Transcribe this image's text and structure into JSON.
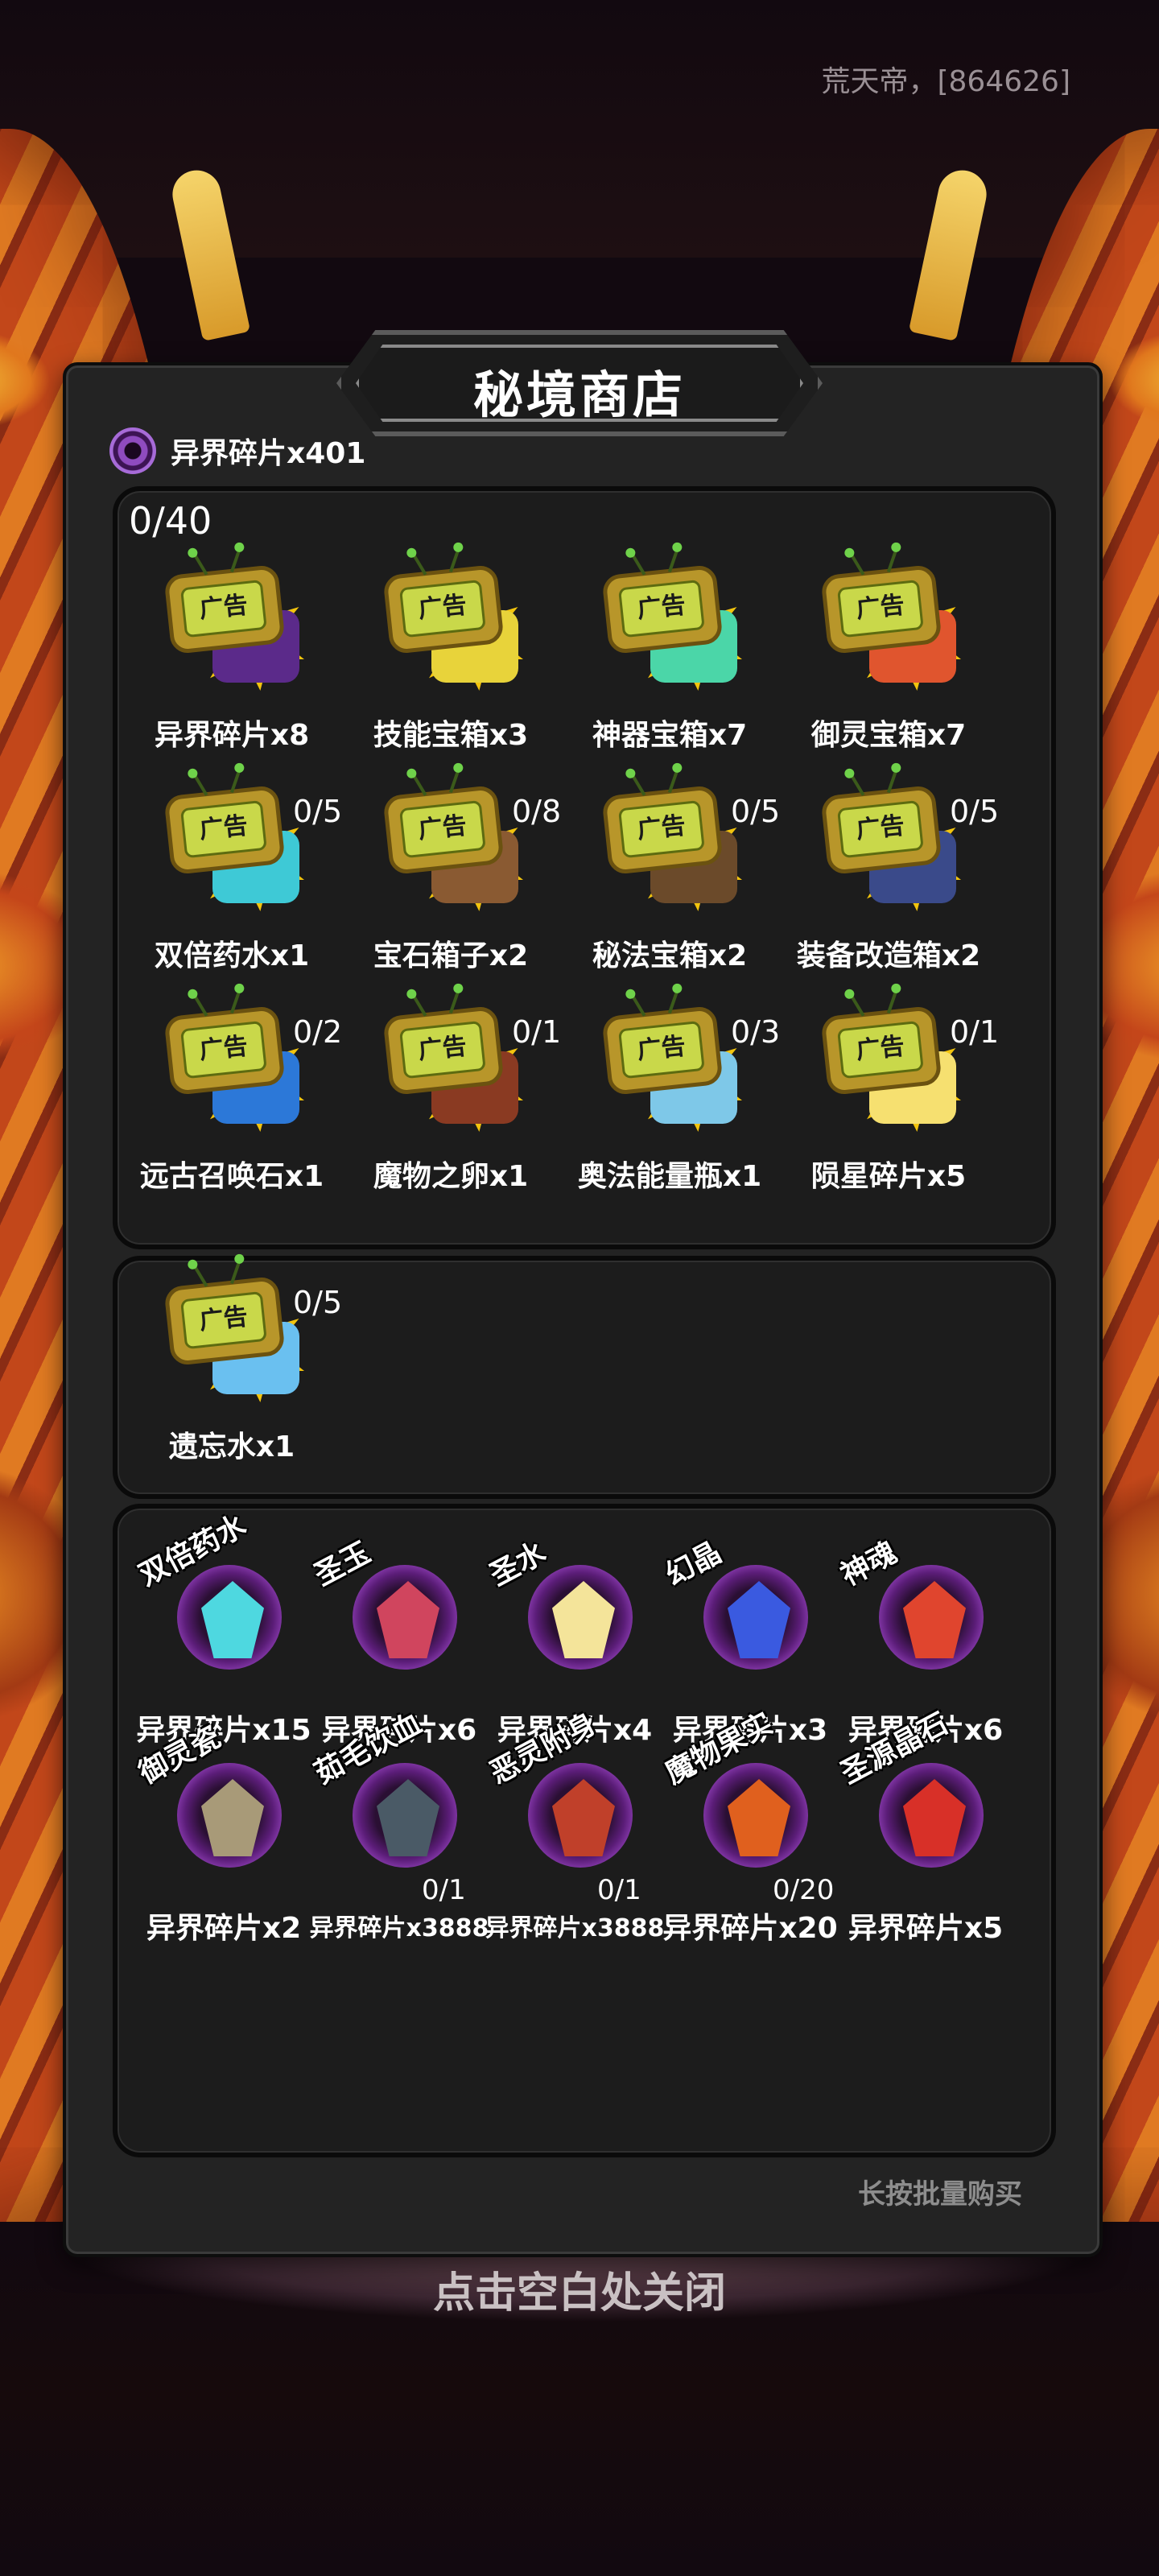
{
  "header": {
    "player_id": "荒天帝，[864626]"
  },
  "shop": {
    "title": "秘境商店",
    "currency": {
      "label": "异界碎片x401",
      "icon": "void-shard-icon"
    },
    "ad_section": {
      "count": "0/40"
    },
    "ad_badge": "广告",
    "ad_items": [
      {
        "name": "异界碎片x8",
        "count": "",
        "prize_color": "#5b2a8a"
      },
      {
        "name": "技能宝箱x3",
        "count": "",
        "prize_color": "#e8d33a"
      },
      {
        "name": "神器宝箱x7",
        "count": "",
        "prize_color": "#4bd6a8"
      },
      {
        "name": "御灵宝箱x7",
        "count": "",
        "prize_color": "#e0552e"
      },
      {
        "name": "双倍药水x1",
        "count": "0/5",
        "prize_color": "#3ec9d6"
      },
      {
        "name": "宝石箱子x2",
        "count": "0/8",
        "prize_color": "#8a5a32"
      },
      {
        "name": "秘法宝箱x2",
        "count": "0/5",
        "prize_color": "#6b4a2a"
      },
      {
        "name": "装备改造箱x2",
        "count": "0/5",
        "prize_color": "#3a4a8a"
      },
      {
        "name": "远古召唤石x1",
        "count": "0/2",
        "prize_color": "#2c78d8"
      },
      {
        "name": "魔物之卵x1",
        "count": "0/1",
        "prize_color": "#8a3a22"
      },
      {
        "name": "奥法能量瓶x1",
        "count": "0/3",
        "prize_color": "#7ec8e8"
      },
      {
        "name": "陨星碎片x5",
        "count": "0/1",
        "prize_color": "#f6e070"
      }
    ],
    "ad_items_2": [
      {
        "name": "遗忘水x1",
        "count": "0/5",
        "prize_color": "#6ac0f0"
      }
    ],
    "shop_items": [
      {
        "tag": "双倍药水",
        "price": "异界碎片x15",
        "limit": "",
        "gem_color": "#4ed8e0"
      },
      {
        "tag": "圣玉",
        "price": "异界碎片x6",
        "limit": "",
        "gem_color": "#d0455e"
      },
      {
        "tag": "圣水",
        "price": "异界碎片x4",
        "limit": "",
        "gem_color": "#f4e49a"
      },
      {
        "tag": "幻晶",
        "price": "异界碎片x3",
        "limit": "",
        "gem_color": "#3a5ae0"
      },
      {
        "tag": "神魂",
        "price": "异界碎片x6",
        "limit": "",
        "gem_color": "#e0452e"
      },
      {
        "tag": "御灵瓷",
        "price": "异界碎片x2",
        "limit": "",
        "gem_color": "#a89a78"
      },
      {
        "tag": "茹毛饮血",
        "price": "异界碎片x3888",
        "limit": "0/1",
        "gem_color": "#4a5a66"
      },
      {
        "tag": "恶灵附身",
        "price": "异界碎片x3888",
        "limit": "0/1",
        "gem_color": "#c0402a"
      },
      {
        "tag": "魔物果实",
        "price": "异界碎片x20",
        "limit": "0/20",
        "gem_color": "#e0601e"
      },
      {
        "tag": "圣源晶石",
        "price": "异界碎片x5",
        "limit": "",
        "gem_color": "#d83028"
      }
    ],
    "bulk_hint": "长按批量购买",
    "close_hint": "点击空白处关闭"
  }
}
